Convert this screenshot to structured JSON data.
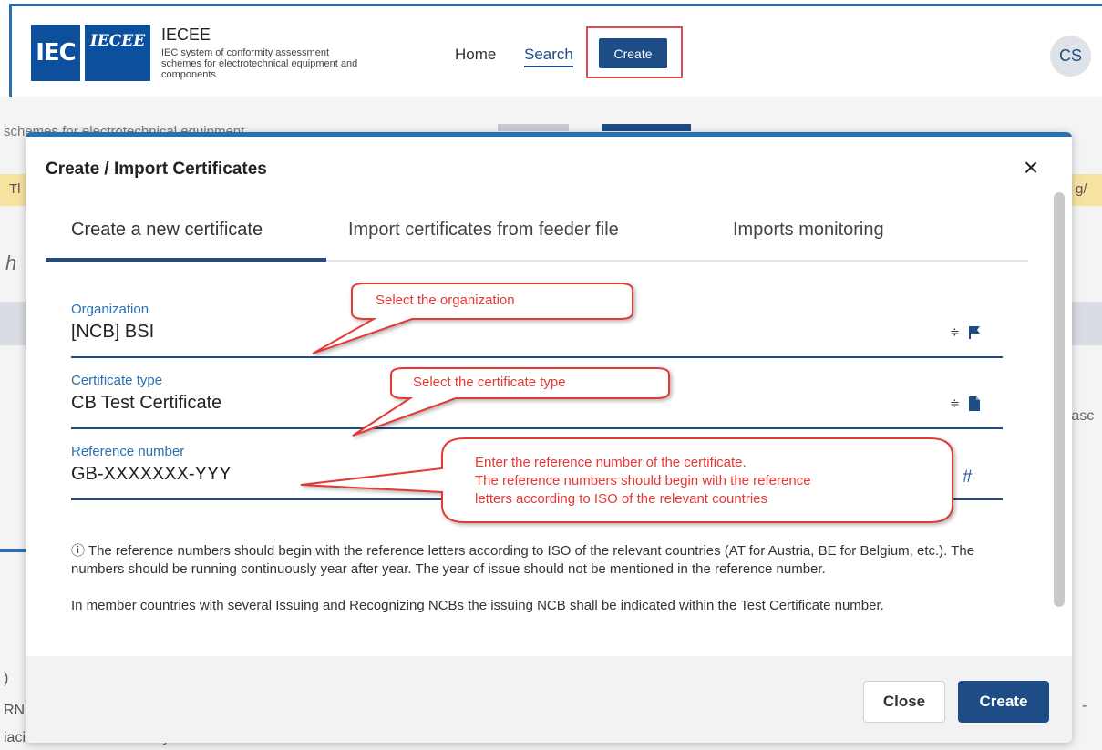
{
  "header": {
    "logo_iec": "IEC",
    "logo_iecee": "IECEE",
    "brand_title": "IECEE",
    "brand_subtitle": "IEC system of conformity assessment schemes for electrotechnical equipment and components",
    "nav": {
      "home": "Home",
      "search": "Search",
      "create": "Create"
    },
    "avatar_initials": "CS"
  },
  "background": {
    "text1": "schemes for electrotechnical equipment",
    "strip_left": "Tl",
    "strip_right": "g/",
    "heading_fragment": "h",
    "asc_fragment": "(asc",
    "bottom1": ")",
    "bottom2": "RN",
    "bottom3": "iación de Normalización y Certific",
    "dash": "-"
  },
  "modal": {
    "title": "Create / Import Certificates",
    "close_icon": "×",
    "tabs": [
      {
        "label": "Create a new certificate",
        "active": true
      },
      {
        "label": "Import certificates from feeder file",
        "active": false
      },
      {
        "label": "Imports monitoring",
        "active": false
      }
    ],
    "fields": {
      "organization": {
        "label": "Organization",
        "value": "[NCB] BSI",
        "icon": "flag-icon"
      },
      "certificate_type": {
        "label": "Certificate type",
        "value": "CB Test Certificate",
        "icon": "document-icon"
      },
      "reference_number": {
        "label": "Reference number",
        "value": "GB-XXXXXXX-YYY",
        "icon": "hash-icon",
        "icon_glyph": "#"
      }
    },
    "sort_glyph": "≑",
    "info_icon": "ⓘ",
    "info_text_1": "The reference numbers should begin with the reference letters according to ISO of the relevant countries (AT for Austria, BE for Belgium, etc.). The numbers should be running continuously year after year. The year of issue should not be mentioned in the reference number.",
    "info_text_2": "In member countries with several Issuing and Recognizing NCBs the issuing NCB shall be indicated within the Test Certificate number.",
    "buttons": {
      "close": "Close",
      "create": "Create"
    }
  },
  "callouts": {
    "organization": "Select the organization",
    "certificate_type": "Select the certificate type",
    "reference_line1": "Enter the reference number of the certificate.",
    "reference_line2": "The reference numbers should begin with the reference",
    "reference_line3": "letters according to ISO of the relevant countries"
  },
  "colors": {
    "accent": "#1e4c87",
    "label_blue": "#2a6fb4",
    "callout_red": "#e53935",
    "highlight_strip": "#f7e3a0"
  }
}
